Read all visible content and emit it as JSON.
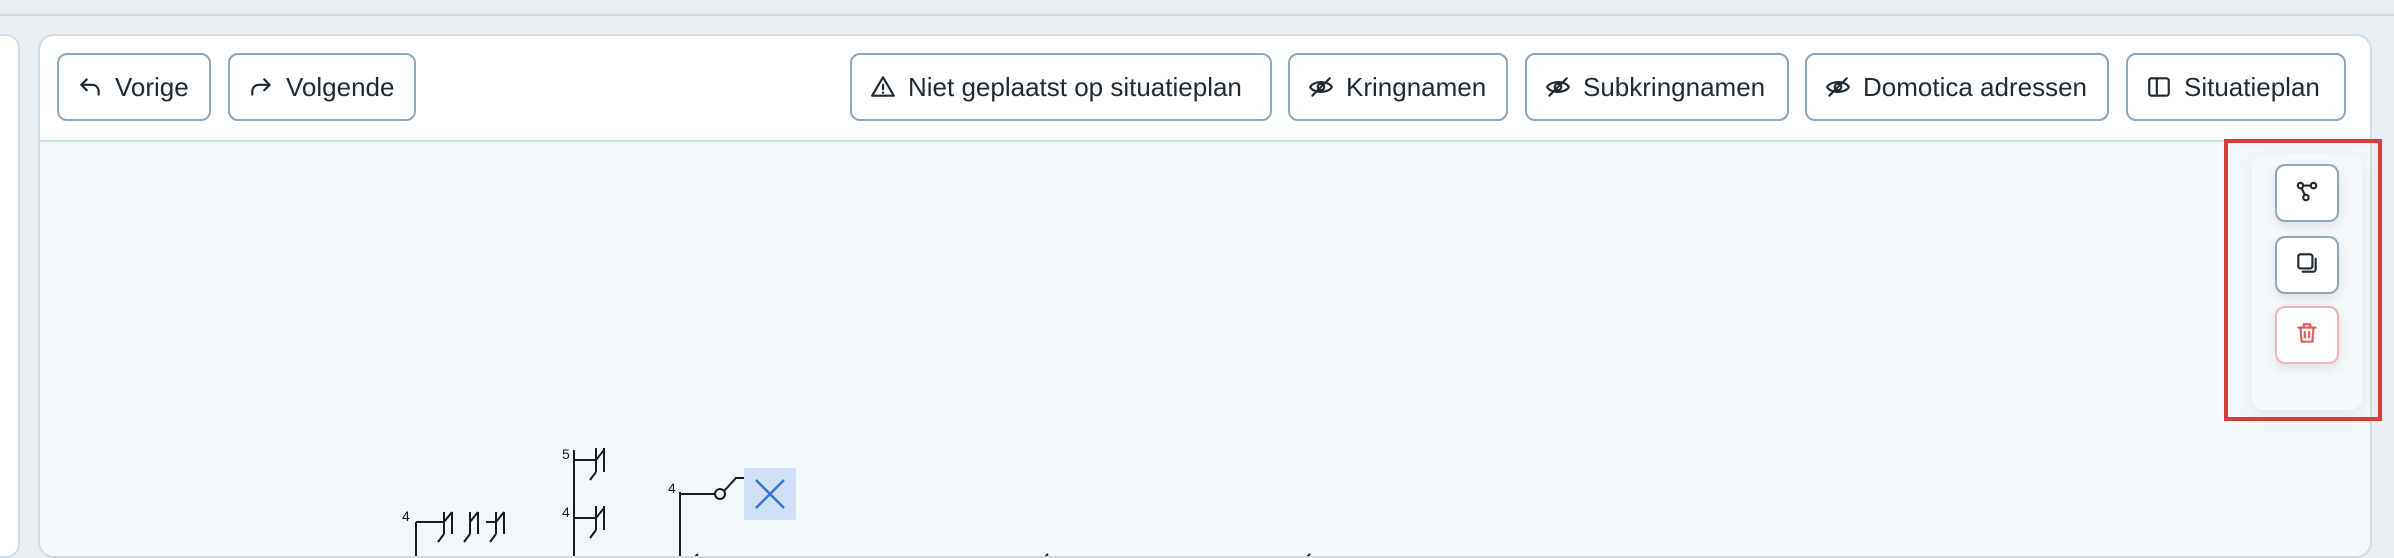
{
  "toolbar": {
    "previous_label": "Vorige",
    "next_label": "Volgende",
    "not_placed_label": "Niet geplaatst op situatieplan",
    "circuit_names_label": "Kringnamen",
    "subcircuit_names_label": "Subkringnamen",
    "domotica_label": "Domotica adressen",
    "site_plan_label": "Situatieplan"
  },
  "side_tools": {
    "items": [
      {
        "name": "share-nodes-icon"
      },
      {
        "name": "copy-icon"
      },
      {
        "name": "trash-icon",
        "color": "#e35d5d"
      }
    ]
  },
  "schematic": {
    "labels": [
      "5",
      "4",
      "4",
      "4"
    ]
  },
  "colors": {
    "accent_border": "#8ea7b7",
    "highlight": "#d93a3a",
    "canvas_bg": "#f2f7f9",
    "selection": "#cfe0f7"
  }
}
